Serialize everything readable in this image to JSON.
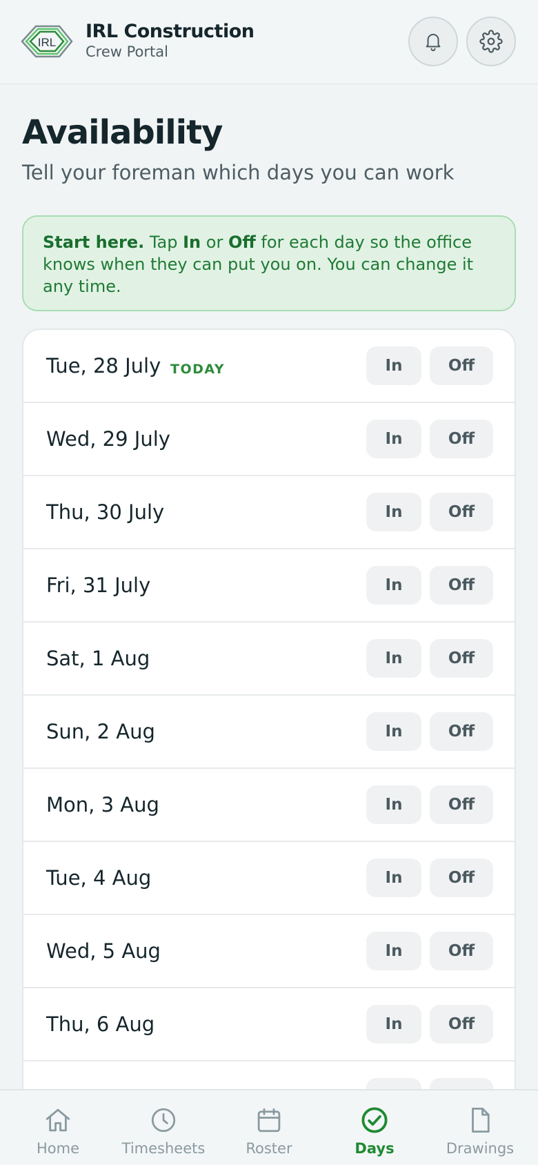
{
  "header": {
    "logo_text": "IRL",
    "brand_name": "IRL Construction",
    "brand_sub": "Crew Portal"
  },
  "page": {
    "title": "Availability",
    "subtitle": "Tell your foreman which days you can work"
  },
  "notice": {
    "lead": "Start here.",
    "text1": " Tap ",
    "in_word": "In",
    "text2": " or ",
    "off_word": "Off",
    "text3": " for each day so the office knows when they can put you on. You can change it any time."
  },
  "days": [
    {
      "label": "Tue, 28 July",
      "badge": "TODAY",
      "in": "In",
      "off": "Off"
    },
    {
      "label": "Wed, 29 July",
      "in": "In",
      "off": "Off"
    },
    {
      "label": "Thu, 30 July",
      "in": "In",
      "off": "Off"
    },
    {
      "label": "Fri, 31 July",
      "in": "In",
      "off": "Off"
    },
    {
      "label": "Sat, 1 Aug",
      "in": "In",
      "off": "Off"
    },
    {
      "label": "Sun, 2 Aug",
      "in": "In",
      "off": "Off"
    },
    {
      "label": "Mon, 3 Aug",
      "in": "In",
      "off": "Off"
    },
    {
      "label": "Tue, 4 Aug",
      "in": "In",
      "off": "Off"
    },
    {
      "label": "Wed, 5 Aug",
      "in": "In",
      "off": "Off"
    },
    {
      "label": "Thu, 6 Aug",
      "in": "In",
      "off": "Off"
    }
  ],
  "nav": [
    {
      "label": "Home",
      "icon": "home-icon"
    },
    {
      "label": "Timesheets",
      "icon": "clock-icon"
    },
    {
      "label": "Roster",
      "icon": "calendar-icon"
    },
    {
      "label": "Days",
      "icon": "check-circle-icon",
      "active": true
    },
    {
      "label": "Drawings",
      "icon": "document-icon"
    }
  ],
  "colors": {
    "accent": "#1f8a32",
    "notice_bg": "#e1f2e4",
    "background": "#f1f4f5"
  }
}
